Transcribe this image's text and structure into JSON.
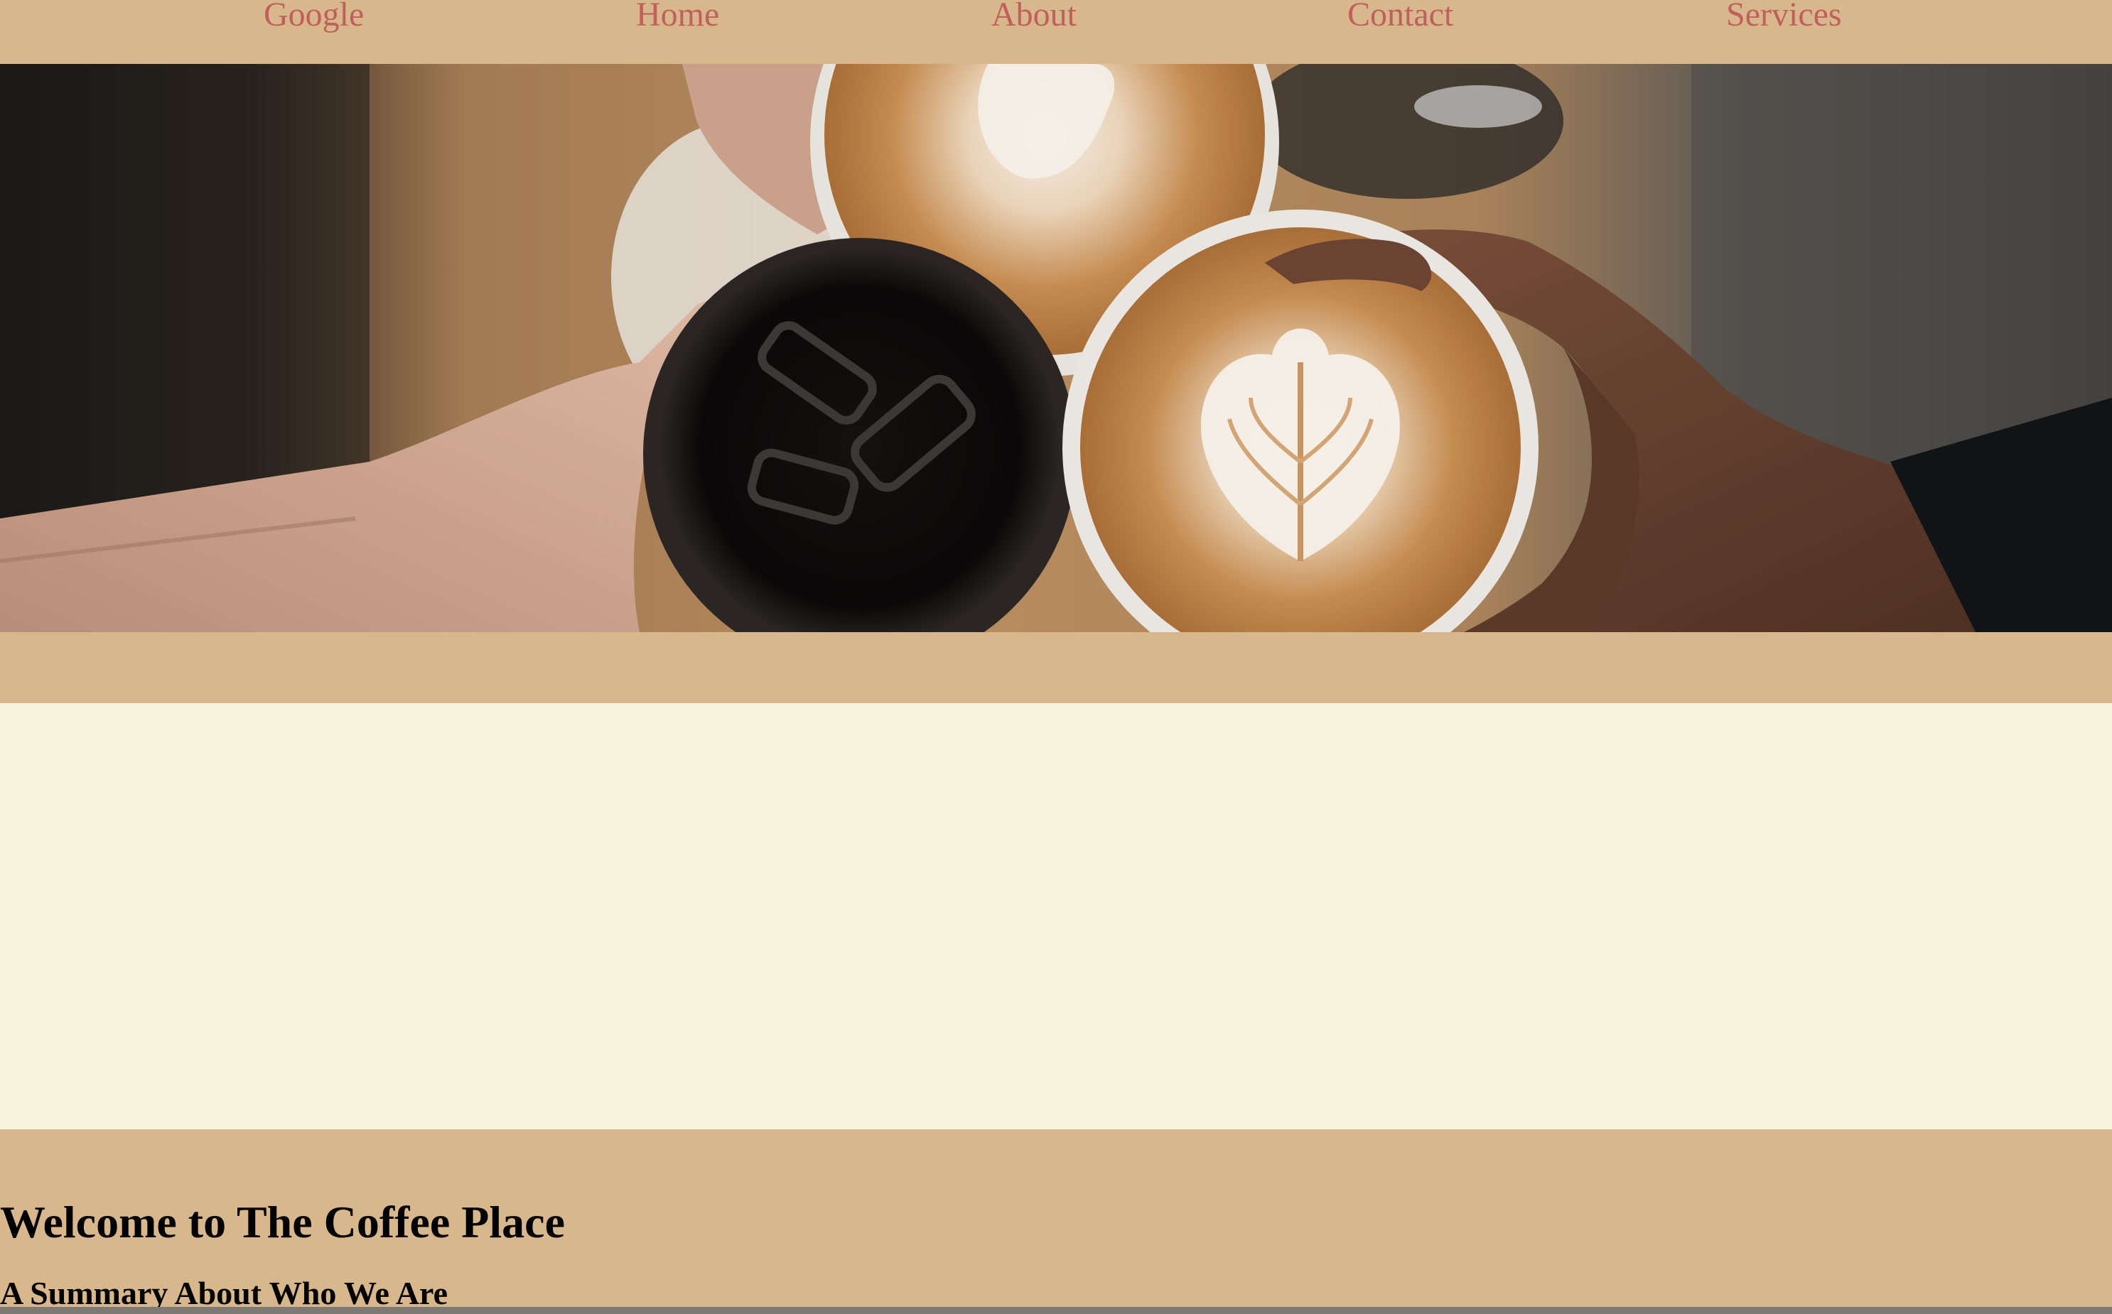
{
  "nav": {
    "google": "Google",
    "home": "Home",
    "about": "About",
    "contact": "Contact",
    "services": "Services"
  },
  "hero": {
    "image_subject": "three hands toasting coffee cups - iced black coffee and two latte art cups - over a wooden table"
  },
  "content": {
    "welcome_heading": "Welcome to The Coffee Place",
    "summary_heading": "A Summary About Who We Are"
  },
  "colors": {
    "page_background": "#d9b78c",
    "nav_link": "#c0605c",
    "cream_panel": "#f6f5dc",
    "heading_text": "#000000"
  }
}
